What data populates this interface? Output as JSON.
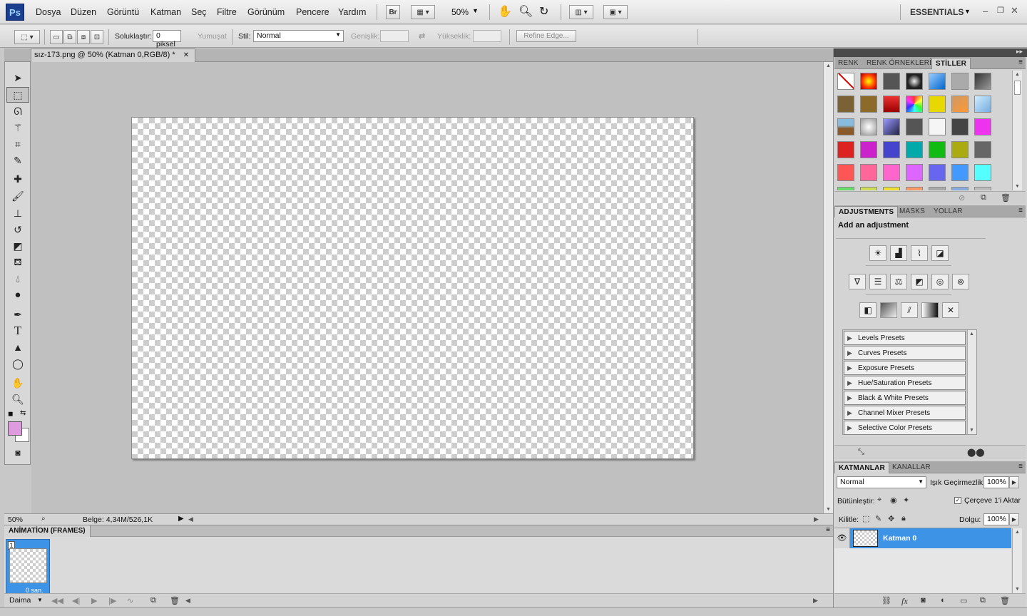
{
  "app": {
    "logo": "Ps",
    "workspace": "ESSENTIALS"
  },
  "menu": [
    "Dosya",
    "Düzen",
    "Görüntü",
    "Katman",
    "Seç",
    "Filtre",
    "Görünüm",
    "Pencere",
    "Yardım"
  ],
  "appbar": {
    "bridge": "Br",
    "zoom": "50%"
  },
  "options": {
    "feather_label": "Soluklaştır:",
    "feather_value": "0 piksel",
    "antialias_label": "Yumuşat",
    "style_label": "Stil:",
    "style_value": "Normal",
    "width_label": "Genişlik:",
    "height_label": "Yükseklik:",
    "refine_edge": "Refine Edge..."
  },
  "document": {
    "tab_title": "sız-173.png @ 50% (Katman 0,RGB/8) *"
  },
  "colors": {
    "foreground": "#de9cde",
    "background": "#ffffff",
    "selected_layer": "#3d93e6",
    "panel": "#d4d4d4"
  },
  "status": {
    "zoom": "50%",
    "doc_info": "Belge: 4,34M/526,1K"
  },
  "animation": {
    "title": "ANİMATİON (FRAMES)",
    "frame_number": "1",
    "frame_delay": "0 san.",
    "loop": "Daima"
  },
  "styles_panel": {
    "tabs": [
      "RENK",
      "RENK ÖRNEKLERİ",
      "STİLLER"
    ]
  },
  "adjustments_panel": {
    "tabs": [
      "ADJUSTMENTS",
      "MASKS",
      "YOLLAR"
    ],
    "heading": "Add an adjustment",
    "presets": [
      "Levels Presets",
      "Curves Presets",
      "Exposure Presets",
      "Hue/Saturation Presets",
      "Black & White Presets",
      "Channel Mixer Presets",
      "Selective Color Presets"
    ]
  },
  "layers_panel": {
    "tabs": [
      "KATMANLAR",
      "KANALLAR"
    ],
    "blend_mode": "Normal",
    "opacity_label": "Işık Geçirmezlik:",
    "opacity": "100%",
    "unify_label": "Bütünleştir:",
    "propagate_label": "Çerçeve 1'i Aktar",
    "lock_label": "Kilitle:",
    "fill_label": "Dolgu:",
    "fill": "100%",
    "layers": [
      {
        "name": "Katman 0",
        "selected": true
      }
    ]
  }
}
